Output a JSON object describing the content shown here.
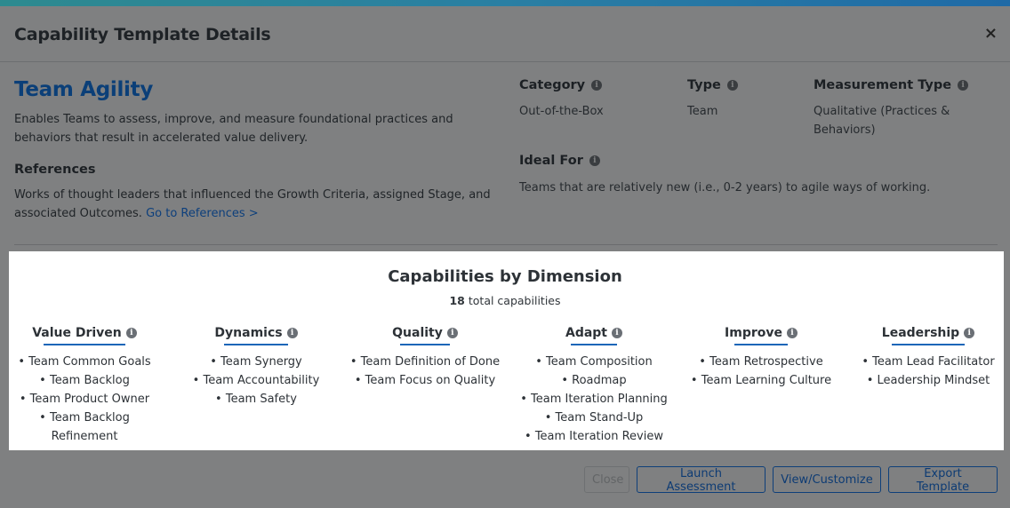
{
  "modal": {
    "title": "Capability Template Details",
    "close_icon": "×"
  },
  "template": {
    "name": "Team Agility",
    "description": "Enables Teams to assess, improve, and measure foundational practices and behaviors that result in accelerated value delivery.",
    "description_line1": "Enables Teams to assess, improve, and measure foundational practices and",
    "description_line2": "behaviors that result in accelerated value delivery.",
    "references_label": "References",
    "references_line1": "Works of thought leaders that influenced the Growth Criteria, assigned Stage, and",
    "references_line2": "associated Outcomes.",
    "references_link": "Go to References >"
  },
  "meta": {
    "category": {
      "label": "Category",
      "value": "Out-of-the-Box"
    },
    "type": {
      "label": "Type",
      "value": "Team"
    },
    "measurement": {
      "label": "Measurement Type",
      "value_line1": "Qualitative (Practices &",
      "value_line2": "Behaviors)"
    },
    "ideal_for": {
      "label": "Ideal For",
      "value": "Teams that are relatively new (i.e., 0-2 years) to agile ways of working."
    }
  },
  "dimensions_panel": {
    "title": "Capabilities by Dimension",
    "total_count": "18",
    "total_suffix": "total capabilities",
    "dimensions": [
      {
        "name": "Value Driven",
        "capabilities": [
          "• Team Common Goals",
          "• Team Backlog",
          "• Team Product Owner",
          "• Team Backlog",
          "Refinement"
        ]
      },
      {
        "name": "Dynamics",
        "capabilities": [
          "• Team Synergy",
          "• Team Accountability",
          "• Team Safety"
        ]
      },
      {
        "name": "Quality",
        "capabilities": [
          "• Team Definition of Done",
          "• Team Focus on Quality"
        ]
      },
      {
        "name": "Adapt",
        "capabilities": [
          "• Team Composition",
          "• Roadmap",
          "• Team Iteration Planning",
          "• Team Stand-Up",
          "• Team Iteration Review"
        ]
      },
      {
        "name": "Improve",
        "capabilities": [
          "• Team Retrospective",
          "• Team Learning Culture"
        ]
      },
      {
        "name": "Leadership",
        "capabilities": [
          "• Team Lead Facilitator",
          "• Leadership Mindset"
        ]
      }
    ]
  },
  "footer": {
    "close_label": "Close",
    "launch_label": "Launch Assessment",
    "customize_label": "View/Customize",
    "export_label": "Export Template"
  },
  "colors": {
    "accent": "#1c66b8",
    "brand_title": "#0b3f78",
    "top_gradient_start": "#2d8a8f",
    "top_gradient_end": "#1f6aa6"
  }
}
